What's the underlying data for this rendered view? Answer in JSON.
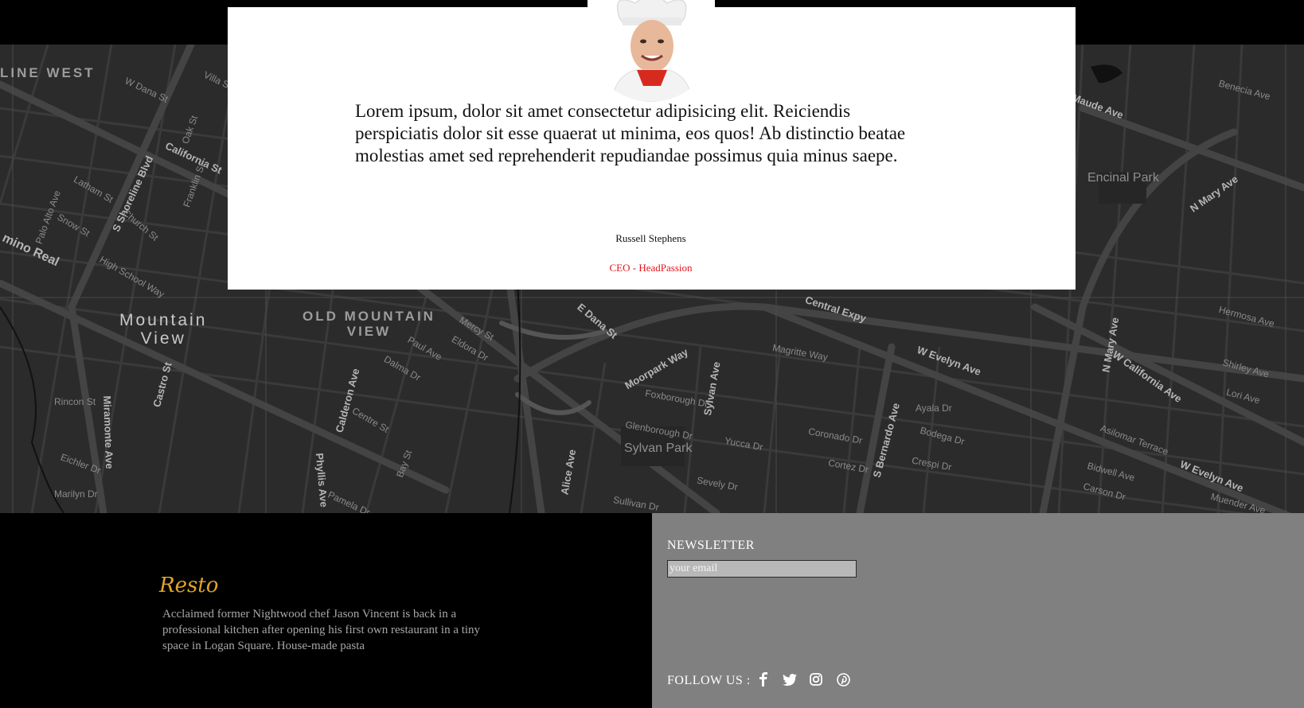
{
  "testimonial": {
    "quote": "Lorem ipsum, dolor sit amet consectetur adipisicing elit. Reiciendis perspiciatis dolor sit esse quaerat ut minima, eos quos! Ab distinctio beatae molestias amet sed reprehenderit repudiandae possimus quia minus saepe.",
    "name": "Russell Stephens",
    "role": "CEO - HeadPassion"
  },
  "map": {
    "labels": {
      "line_west": "LINE WEST",
      "mountain_view": "Mountain\nView",
      "old_mountain_view": "OLD MOUNTAIN\nVIEW",
      "encinal_park": "Encinal Park",
      "sylvan_park": "Sylvan Park",
      "california_st": "California St",
      "shoreline_blvd": "S Shoreline Blvd",
      "central_expy": "Central Expy",
      "w_evelyn_ave": "W Evelyn Ave",
      "w_evelyn_ave_2": "W Evelyn Ave",
      "moorpark_way": "Moorpark Way",
      "calderon_ave": "Calderon Ave",
      "castro_st": "Castro St",
      "sylvan_ave": "Sylvan Ave",
      "s_bernardo_ave": "S Bernardo Ave",
      "w_california_ave": "W California Ave",
      "n_mary_ave": "N Mary Ave",
      "n_mary_ave_2": "N Mary Ave",
      "camino_real": "mino Real",
      "miramonte_ave": "Miramonte Ave",
      "alice_ave": "Alice Ave",
      "phyllis_ave": "Phyllis Ave",
      "e_dana_st": "E Dana St",
      "maude_ave": "Maude Ave",
      "rincon_st": "Rincon St",
      "marilyn_dr": "Marilyn Dr",
      "eichler_dr": "Eichler Dr",
      "church_st": "Church St",
      "latham_st": "Latham St",
      "high_school_way": "High School Way",
      "mercy_st": "Mercy St",
      "ayala_dr": "Ayala Dr",
      "bodega_dr": "Bodega Dr",
      "coronado_dr": "Coronado Dr",
      "cortez_dr": "Cortez Dr",
      "crespi_dr": "Crespi Dr",
      "carson_dr": "Carson Dr",
      "bidwell_ave": "Bidwell Ave",
      "benecia_ave": "Benecia Ave",
      "shirley_ave": "Shirley Ave",
      "lori_ave": "Lori Ave",
      "hermosa_ave": "Hermosa Ave",
      "w_dana_st": "W Dana St",
      "oak_st": "Oak St",
      "villa_st": "Villa St",
      "franklin_st": "Franklin St",
      "snow_st": "Snow St",
      "palo_alto_ave": "Palo Alto Ave",
      "paul_ave": "Paul Ave",
      "dalma_dr": "Dalma Dr",
      "eldora_dr": "Eldora Dr",
      "centre_st": "Centre St",
      "bay_st": "Bay St",
      "foxborough_dr": "Foxborough Dr",
      "glenborough_dr": "Glenborough Dr",
      "sevely_dr": "Sevely Dr",
      "sullivan_dr": "Sullivan Dr",
      "yucca_dr": "Yucca Dr",
      "magritte_way": "Magritte Way",
      "pamela_dr": "Pamela Dr",
      "muender_ave": "Muender Ave",
      "aslomar_terrace": "Asilomar Terrace"
    }
  },
  "footer": {
    "brand": "Resto",
    "about": "Acclaimed former Nightwood chef Jason Vincent is back in a professional kitchen after opening his first own restaurant in a tiny space in Logan Square. House-made pasta",
    "newsletter_title": "NEWSLETTER",
    "newsletter_placeholder": "your email",
    "follow_label": "FOLLOW US :",
    "social": [
      "facebook-icon",
      "twitter-icon",
      "instagram-icon",
      "pinterest-icon"
    ]
  },
  "colors": {
    "brand_gold": "#e2a32a",
    "role_red": "#e4141b",
    "footer_gray": "#808080",
    "map_bg": "#2b2b2b"
  }
}
